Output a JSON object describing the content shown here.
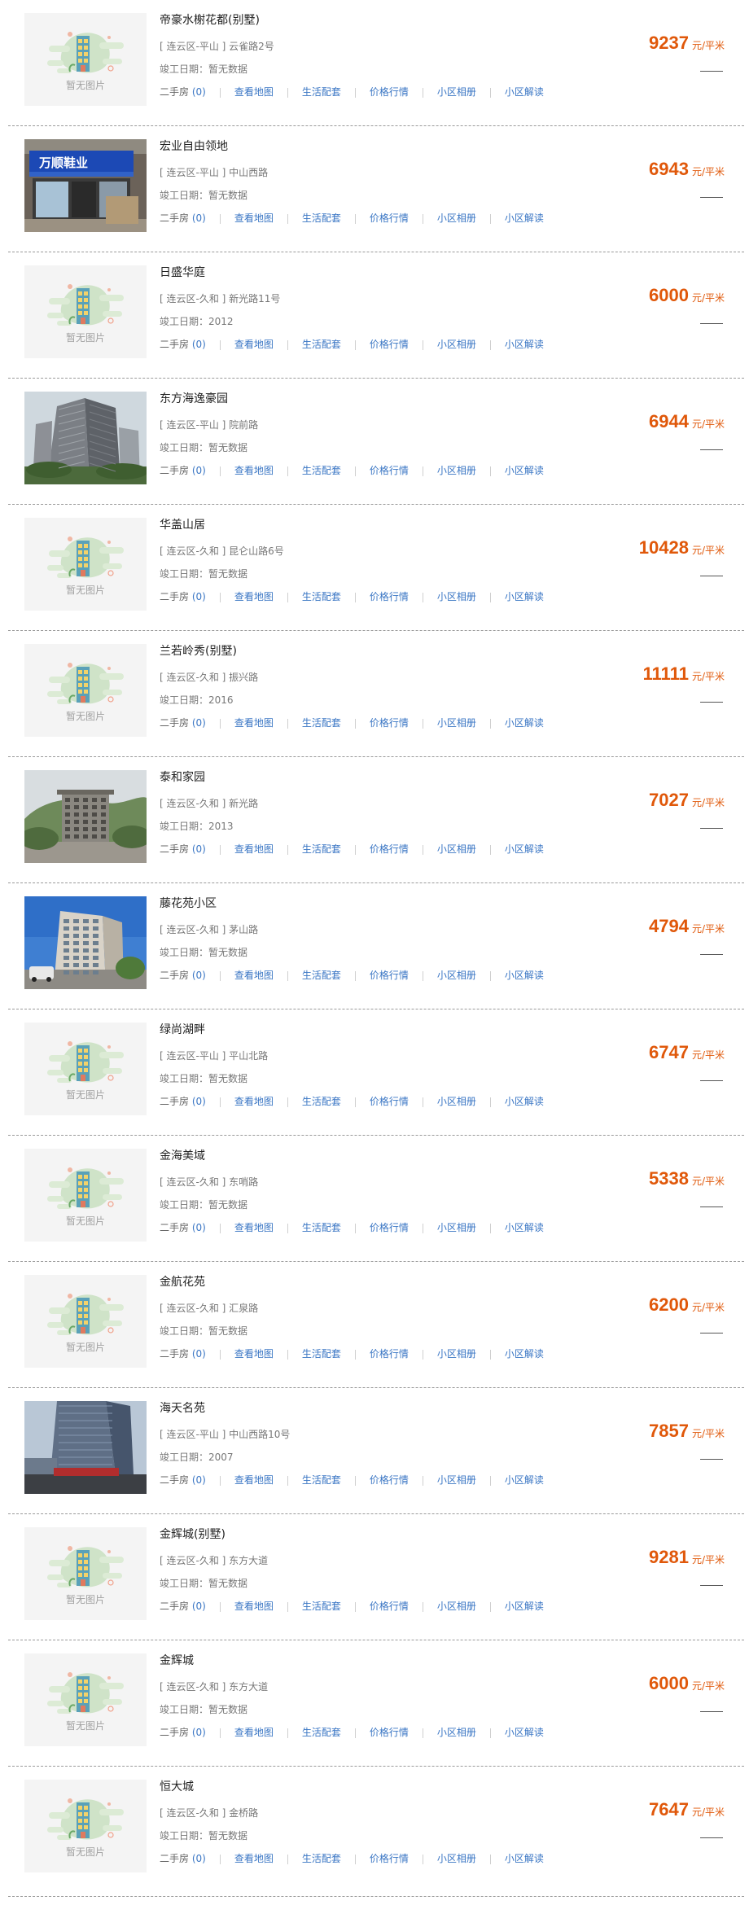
{
  "labels": {
    "no_image": "暂无图片",
    "secondhand": "二手房",
    "map": "查看地图",
    "facilities": "生活配套",
    "market": "价格行情",
    "album": "小区相册",
    "analysis": "小区解读",
    "built_prefix": "竣工日期："
  },
  "colors": {
    "price": "#e0580a",
    "link": "#3a76c4",
    "divider": "#9a9a9a"
  },
  "items": [
    {
      "name": "帝豪水榭花都(别墅)",
      "district": "[ 连云区-平山 ]",
      "street": "云雀路2号",
      "built": "暂无数据",
      "secondhand_count": "(0)",
      "price": "9237",
      "price_unit": "元/平米",
      "image": "placeholder-building-icon"
    },
    {
      "name": "宏业自由领地",
      "district": "[ 连云区-平山 ]",
      "street": "中山西路",
      "built": "暂无数据",
      "secondhand_count": "(0)",
      "price": "6943",
      "price_unit": "元/平米",
      "image": "photo-storefront",
      "sign_text": "万顺鞋业"
    },
    {
      "name": "日盛华庭",
      "district": "[ 连云区-久和 ]",
      "street": "新光路11号",
      "built": "2012",
      "secondhand_count": "(0)",
      "price": "6000",
      "price_unit": "元/平米",
      "image": "placeholder-building-icon"
    },
    {
      "name": "东方海逸豪园",
      "district": "[ 连云区-平山 ]",
      "street": "院前路",
      "built": "暂无数据",
      "secondhand_count": "(0)",
      "price": "6944",
      "price_unit": "元/平米",
      "image": "photo-highrise-towers"
    },
    {
      "name": "华盖山居",
      "district": "[ 连云区-久和 ]",
      "street": "昆仑山路6号",
      "built": "暂无数据",
      "secondhand_count": "(0)",
      "price": "10428",
      "price_unit": "元/平米",
      "image": "placeholder-building-icon"
    },
    {
      "name": "兰若岭秀(别墅)",
      "district": "[ 连云区-久和 ]",
      "street": "振兴路",
      "built": "2016",
      "secondhand_count": "(0)",
      "price": "11111",
      "price_unit": "元/平米",
      "image": "placeholder-building-icon"
    },
    {
      "name": "泰和家园",
      "district": "[ 连云区-久和 ]",
      "street": "新光路",
      "built": "2013",
      "secondhand_count": "(0)",
      "price": "7027",
      "price_unit": "元/平米",
      "image": "photo-midrise-hillside"
    },
    {
      "name": "藤花苑小区",
      "district": "[ 连云区-久和 ]",
      "street": "茅山路",
      "built": "暂无数据",
      "secondhand_count": "(0)",
      "price": "4794",
      "price_unit": "元/平米",
      "image": "photo-apartment-blue-sky"
    },
    {
      "name": "绿尚湖畔",
      "district": "[ 连云区-平山 ]",
      "street": "平山北路",
      "built": "暂无数据",
      "secondhand_count": "(0)",
      "price": "6747",
      "price_unit": "元/平米",
      "image": "placeholder-building-icon"
    },
    {
      "name": "金海美域",
      "district": "[ 连云区-久和 ]",
      "street": "东哨路",
      "built": "暂无数据",
      "secondhand_count": "(0)",
      "price": "5338",
      "price_unit": "元/平米",
      "image": "placeholder-building-icon"
    },
    {
      "name": "金航花苑",
      "district": "[ 连云区-久和 ]",
      "street": "汇泉路",
      "built": "暂无数据",
      "secondhand_count": "(0)",
      "price": "6200",
      "price_unit": "元/平米",
      "image": "placeholder-building-icon"
    },
    {
      "name": "海天名苑",
      "district": "[ 连云区-平山 ]",
      "street": "中山西路10号",
      "built": "2007",
      "secondhand_count": "(0)",
      "price": "7857",
      "price_unit": "元/平米",
      "image": "photo-tower-street"
    },
    {
      "name": "金辉城(别墅)",
      "district": "[ 连云区-久和 ]",
      "street": "东方大道",
      "built": "暂无数据",
      "secondhand_count": "(0)",
      "price": "9281",
      "price_unit": "元/平米",
      "image": "placeholder-building-icon"
    },
    {
      "name": "金辉城",
      "district": "[ 连云区-久和 ]",
      "street": "东方大道",
      "built": "暂无数据",
      "secondhand_count": "(0)",
      "price": "6000",
      "price_unit": "元/平米",
      "image": "placeholder-building-icon"
    },
    {
      "name": "恒大城",
      "district": "[ 连云区-久和 ]",
      "street": "金桥路",
      "built": "暂无数据",
      "secondhand_count": "(0)",
      "price": "7647",
      "price_unit": "元/平米",
      "image": "placeholder-building-icon"
    }
  ]
}
